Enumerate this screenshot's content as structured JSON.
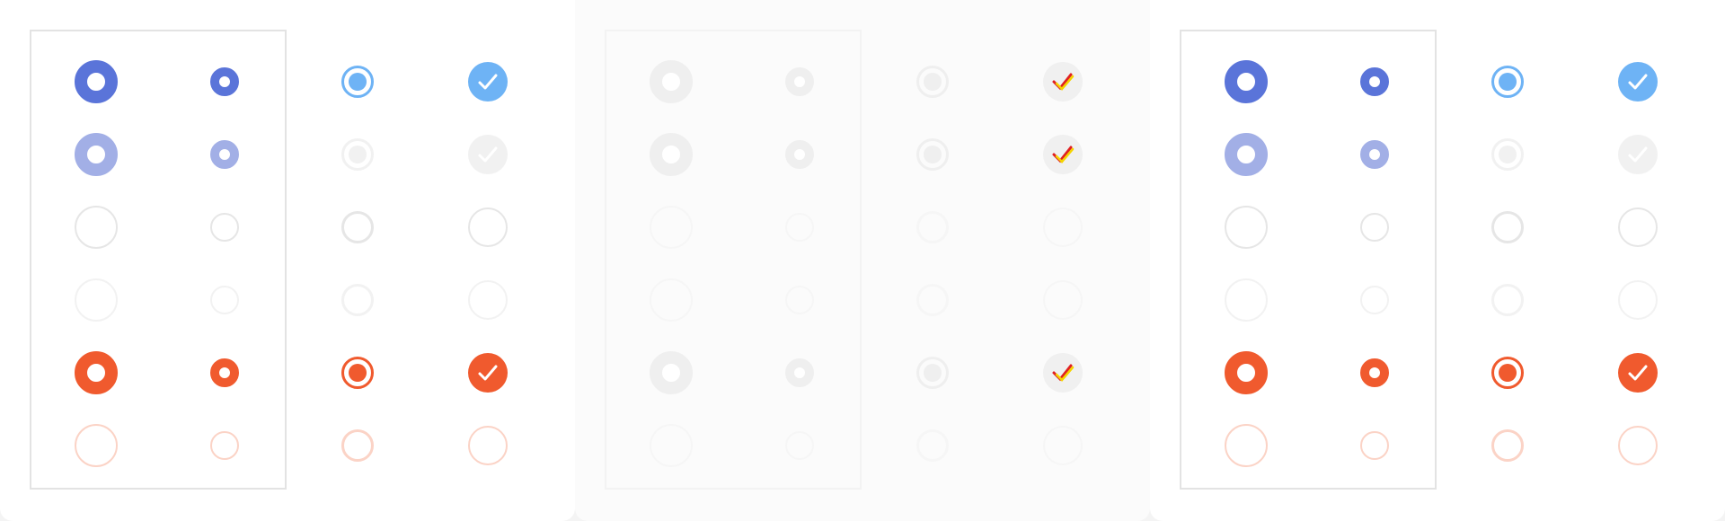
{
  "panels": [
    {
      "name": "panel-left",
      "theme": "normal"
    },
    {
      "name": "panel-center",
      "theme": "disabled"
    },
    {
      "name": "panel-right",
      "theme": "normal"
    }
  ],
  "columns": [
    "radio-large",
    "radio-small",
    "radio-outline",
    "checkbox-round"
  ],
  "rows": [
    {
      "state": "checked-primary",
      "color": "#5a74d9",
      "accent": "#6eb3f5",
      "checked": true,
      "outline_checked": true
    },
    {
      "state": "checked-primary-disabled",
      "color": "#a2afe6",
      "accent": "#f2f2f2",
      "checked": true,
      "outline_checked": false
    },
    {
      "state": "unchecked",
      "color": "#e6e6e6",
      "accent": "#e6e6e6",
      "checked": false
    },
    {
      "state": "unchecked-disabled",
      "color": "#f2f2f2",
      "accent": "#f2f2f2",
      "checked": false
    },
    {
      "state": "checked-error",
      "color": "#f05a2e",
      "accent": "#f05a2e",
      "checked": true,
      "outline_checked": true
    },
    {
      "state": "unchecked-error",
      "color": "#fbd3c6",
      "accent": "#fbd3c6",
      "checked": false
    }
  ],
  "colors": {
    "panel_background": "#ffffff",
    "page_background": "#f4f4f4",
    "disabled_fill": "#f1f1f1",
    "check_mark": "#ffffff",
    "glitch_red": "#e02020",
    "glitch_yellow": "#f5d400"
  },
  "icons": [
    "radio-filled-icon",
    "radio-outline-icon",
    "check-circle-icon"
  ]
}
